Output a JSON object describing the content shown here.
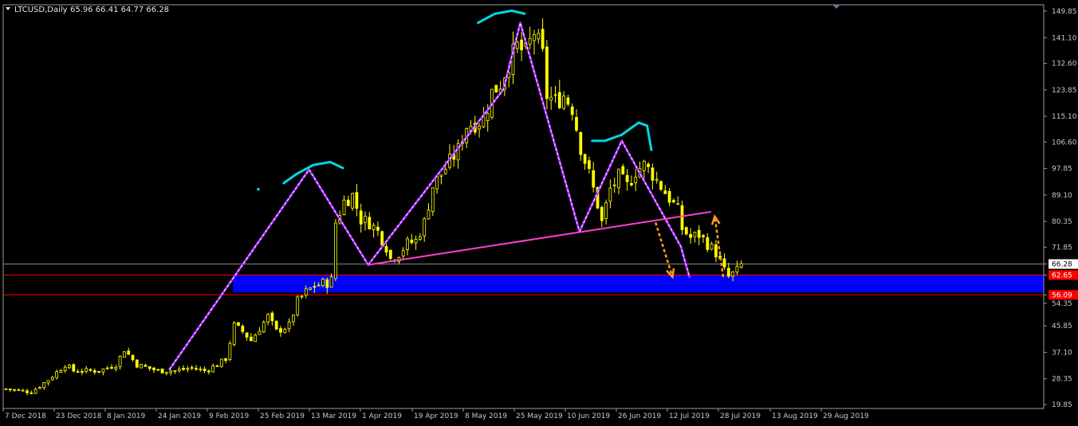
{
  "header": {
    "symbol": "LTCUSD,Daily",
    "ohlc": "65.96 66.41 64.77 66.28"
  },
  "colors": {
    "background": "#000000",
    "candle_up": "#ffff00",
    "candle_down": "#ffff00",
    "price_line": "#8c8c8c",
    "level_line": "#ff0000",
    "zone_fill": "#0000ff",
    "pattern_line": "#a020f0",
    "neckline": "#ff3fd0",
    "shoulder_mark": "#00d8e0",
    "arrow": "#ff9a20",
    "axis_text": "#c8c8c8"
  },
  "chart_data": {
    "type": "candlestick",
    "instrument": "LTCUSD",
    "timeframe": "Daily",
    "y_ticks": [
      "149.85",
      "141.10",
      "132.60",
      "123.85",
      "115.10",
      "106.60",
      "97.85",
      "89.10",
      "80.35",
      "71.85",
      "66.28",
      "62.65",
      "56.09",
      "54.35",
      "45.85",
      "37.10",
      "28.35",
      "19.85"
    ],
    "y_tick_values": [
      149.85,
      141.1,
      132.6,
      123.85,
      115.1,
      106.6,
      97.85,
      89.1,
      80.35,
      71.85,
      54.35,
      45.85,
      37.1,
      28.35,
      19.85
    ],
    "ylim": [
      19.85,
      149.85
    ],
    "x_ticks": [
      "7 Dec 2018",
      "23 Dec 2018",
      "8 Jan 2019",
      "24 Jan 2019",
      "9 Feb 2019",
      "25 Feb 2019",
      "13 Mar 2019",
      "1 Apr 2019",
      "19 Apr 2019",
      "8 May 2019",
      "25 May 2019",
      "10 Jun 2019",
      "26 Jun 2019",
      "12 Jul 2019",
      "28 Jul 2019",
      "13 Aug 2019",
      "29 Aug 2019"
    ],
    "current_price": 66.28,
    "resistance_level": 62.65,
    "support_level": 56.09,
    "price_path": [
      [
        0,
        25
      ],
      [
        6,
        24
      ],
      [
        10,
        28
      ],
      [
        14,
        33
      ],
      [
        16,
        31
      ],
      [
        22,
        31
      ],
      [
        26,
        33
      ],
      [
        28,
        38
      ],
      [
        31,
        33
      ],
      [
        36,
        31
      ],
      [
        40,
        31
      ],
      [
        44,
        32
      ],
      [
        47,
        31
      ],
      [
        50,
        33
      ],
      [
        52,
        35
      ],
      [
        54,
        46
      ],
      [
        56,
        44
      ],
      [
        58,
        41
      ],
      [
        60,
        45
      ],
      [
        62,
        49
      ],
      [
        64,
        44
      ],
      [
        67,
        46
      ],
      [
        69,
        54
      ],
      [
        71,
        57
      ],
      [
        73,
        59
      ],
      [
        75,
        60
      ],
      [
        76,
        60
      ],
      [
        77,
        61
      ],
      [
        78,
        80
      ],
      [
        80,
        87
      ],
      [
        82,
        89
      ],
      [
        84,
        81
      ],
      [
        86,
        80
      ],
      [
        88,
        77
      ],
      [
        90,
        72
      ],
      [
        91,
        68
      ],
      [
        93,
        70
      ],
      [
        95,
        73
      ],
      [
        97,
        74
      ],
      [
        99,
        80
      ],
      [
        101,
        92
      ],
      [
        103,
        96
      ],
      [
        105,
        100
      ],
      [
        107,
        104
      ],
      [
        109,
        112
      ],
      [
        111,
        113
      ],
      [
        113,
        114
      ],
      [
        115,
        123
      ],
      [
        117,
        126
      ],
      [
        119,
        133
      ],
      [
        121,
        138
      ],
      [
        123,
        136
      ],
      [
        125,
        143
      ],
      [
        127,
        135
      ],
      [
        128,
        122
      ],
      [
        130,
        120
      ],
      [
        132,
        122
      ],
      [
        134,
        118
      ],
      [
        136,
        105
      ],
      [
        138,
        96
      ],
      [
        140,
        86
      ],
      [
        141,
        80
      ],
      [
        143,
        91
      ],
      [
        145,
        95
      ],
      [
        147,
        92
      ],
      [
        149,
        97
      ],
      [
        151,
        99
      ],
      [
        153,
        96
      ],
      [
        155,
        92
      ],
      [
        157,
        88
      ],
      [
        159,
        84
      ],
      [
        160,
        78
      ],
      [
        162,
        75
      ],
      [
        164,
        76
      ],
      [
        166,
        73
      ],
      [
        168,
        70
      ],
      [
        170,
        64
      ],
      [
        171,
        62
      ],
      [
        173,
        64
      ],
      [
        174,
        66
      ]
    ]
  },
  "annotations": {
    "left_shoulder_line": [
      [
        39,
        31.5
      ],
      [
        72,
        97.5
      ],
      [
        86,
        66
      ]
    ],
    "head_line": [
      [
        86,
        66
      ],
      [
        118,
        124
      ],
      [
        122,
        146
      ],
      [
        136,
        77
      ]
    ],
    "right_shoulder_line": [
      [
        136,
        77
      ],
      [
        146,
        107
      ],
      [
        160,
        72
      ],
      [
        162,
        62
      ]
    ],
    "neckline": [
      [
        86,
        66
      ],
      [
        167,
        83.5
      ]
    ],
    "left_shoulder_mark": [
      [
        66,
        93
      ],
      [
        69,
        96
      ],
      [
        73,
        99
      ],
      [
        77,
        100
      ],
      [
        80,
        98
      ]
    ],
    "head_mark": [
      [
        112,
        146
      ],
      [
        116,
        149
      ],
      [
        120,
        150
      ],
      [
        123,
        149
      ]
    ],
    "right_shoulder_mark": [
      [
        139,
        107
      ],
      [
        142,
        107
      ],
      [
        146,
        109
      ],
      [
        150,
        113
      ],
      [
        152,
        112
      ],
      [
        153,
        104
      ]
    ],
    "arrow_down": [
      [
        154,
        80
      ],
      [
        158,
        62
      ]
    ],
    "arrow_up": [
      [
        170,
        62
      ],
      [
        168,
        82
      ]
    ]
  }
}
